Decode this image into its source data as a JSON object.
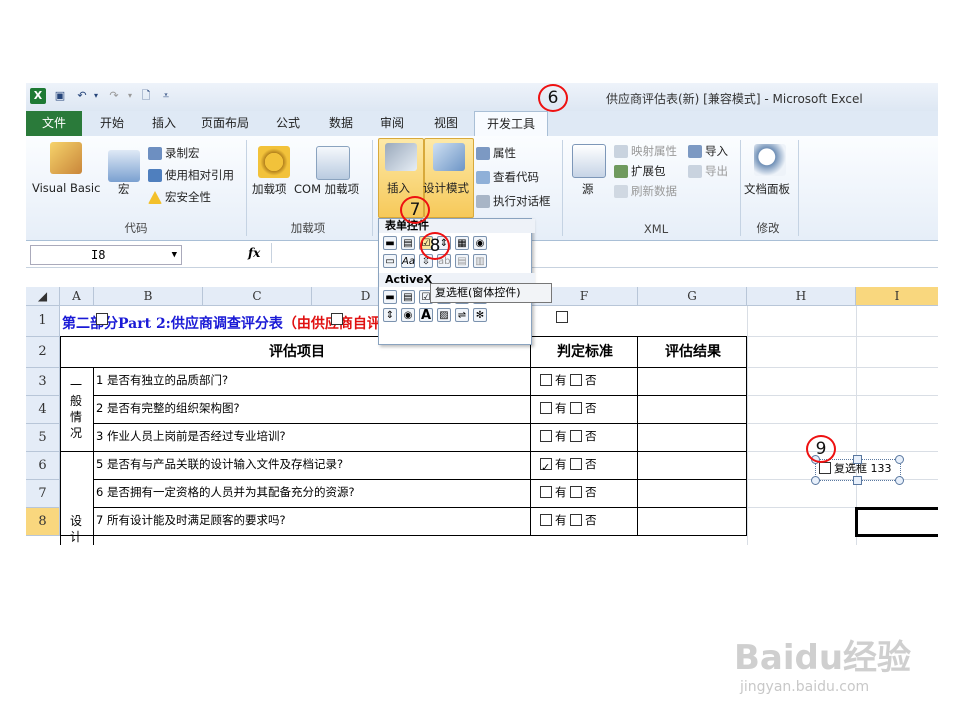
{
  "window": {
    "title": "供应商评估表(新)  [兼容模式]  -  Microsoft Excel",
    "excel_icon": "X"
  },
  "tabs": [
    "文件",
    "开始",
    "插入",
    "页面布局",
    "公式",
    "数据",
    "审阅",
    "视图",
    "开发工具"
  ],
  "active_tab": "开发工具",
  "ribbon": {
    "code_group": {
      "label": "代码",
      "visual_basic": "Visual Basic",
      "macro": "宏",
      "record_macro": "录制宏",
      "relative_ref": "使用相对引用",
      "macro_security": "宏安全性"
    },
    "addins_group": {
      "label": "加载项",
      "addins": "加载项",
      "com_addins": "COM 加载项"
    },
    "controls_group": {
      "insert": "插入",
      "design_mode": "设计模式",
      "properties": "属性",
      "view_code": "查看代码",
      "run_dialog": "执行对话框"
    },
    "xml_group": {
      "label": "XML",
      "source": "源",
      "map_properties": "映射属性",
      "expansion_pack": "扩展包",
      "refresh_data": "刷新数据",
      "import": "导入",
      "export": "导出"
    },
    "modify_group": {
      "label": "修改",
      "document_panel": "文档面板"
    }
  },
  "formula_bar": {
    "name_box": "I8",
    "fx": "fx"
  },
  "columns": [
    "A",
    "B",
    "C",
    "D",
    "F",
    "G",
    "H",
    "I"
  ],
  "rows": [
    "1",
    "2",
    "3",
    "4",
    "5",
    "6",
    "7",
    "8"
  ],
  "sheet": {
    "title_blue": "第二部分Part 2:供应商调查评分表",
    "title_red": "（由供应商自评，到工厂后复审）",
    "header_item": "评估项目",
    "header_standard": "判定标准",
    "header_result": "评估结果",
    "category_general": "一般情况",
    "category_design": "设计",
    "yes": "有",
    "no": "否",
    "items": [
      "1 是否有独立的品质部门?",
      "2 是否有完整的组织架构图?",
      "3 作业人员上岗前是否经过专业培训?",
      "5 是否有与产品关联的设计输入文件及存档记录?",
      "6 是否拥有一定资格的人员并为其配备充分的资源?",
      "7 所有设计能及时满足顾客的要求吗?"
    ],
    "checked_row": 3
  },
  "control_menu": {
    "form_controls": "表单控件",
    "activex": "ActiveX",
    "tooltip": "复选框(窗体控件)"
  },
  "placed_control": {
    "label": "复选框 133"
  },
  "markers": [
    "6",
    "7",
    "8",
    "9"
  ],
  "watermark": {
    "brand": "Baidu经验",
    "url": "jingyan.baidu.com"
  },
  "colors": {
    "title_blue": "#1a1ad6",
    "title_red": "#e01010",
    "file_tab": "#2a7a3a",
    "marker": "#e11111",
    "selected_header": "#f9d77e"
  }
}
